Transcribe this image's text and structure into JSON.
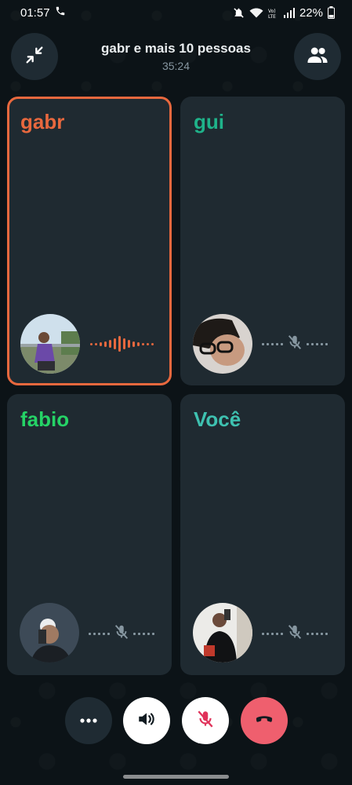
{
  "status_bar": {
    "time": "01:57",
    "battery": "22%"
  },
  "header": {
    "title": "gabr e mais 10 pessoas",
    "timer": "35:24",
    "minimize_icon": "minimize-arrows-icon",
    "participants_icon": "group-icon"
  },
  "participants": [
    {
      "name": "gabr",
      "color": "#e8683e",
      "speaking": true,
      "muted": false
    },
    {
      "name": "gui",
      "color": "#1fb38a",
      "speaking": false,
      "muted": true
    },
    {
      "name": "fabio",
      "color": "#25d366",
      "speaking": false,
      "muted": true
    },
    {
      "name": "Você",
      "color": "#3ec1b0",
      "speaking": false,
      "muted": true
    }
  ],
  "controls": {
    "more_icon": "more-options-icon",
    "speaker_icon": "speaker-icon",
    "mute_icon": "microphone-muted-icon",
    "end_icon": "end-call-icon",
    "end_color": "#ef5f6e"
  }
}
